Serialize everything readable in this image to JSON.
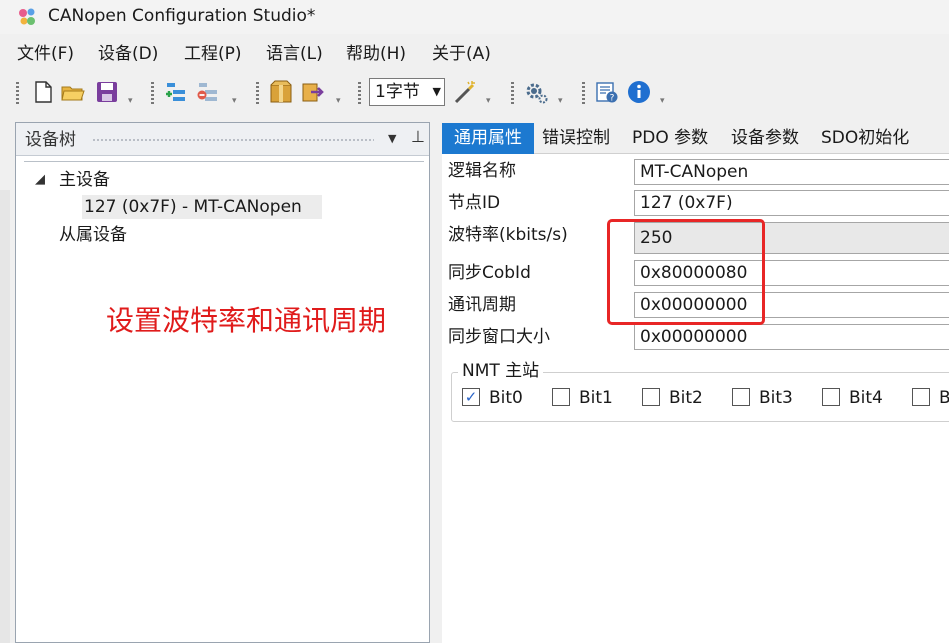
{
  "window": {
    "title": "CANopen Configuration Studio*"
  },
  "menu": {
    "items": [
      "文件(F)",
      "设备(D)",
      "工程(P)",
      "语言(L)",
      "帮助(H)",
      "关于(A)"
    ]
  },
  "toolbar": {
    "icons": [
      "new-file-icon",
      "open-folder-icon",
      "save-icon",
      "add-device-icon",
      "remove-device-icon",
      "package-icon",
      "export-icon",
      "wand-icon",
      "settings-gear-icon",
      "help-icon",
      "info-icon"
    ],
    "byte_select": {
      "value": "1字节"
    }
  },
  "device_tree": {
    "title": "设备树",
    "master_label": "主设备",
    "master_child": "127 (0x7F)  -  MT-CANopen",
    "slave_label": "从属设备"
  },
  "annotation": {
    "text": "设置波特率和通讯周期",
    "color": "#e01b1b"
  },
  "tabs": [
    "通用属性",
    "错误控制",
    "PDO 参数",
    "设备参数",
    "SDO初始化"
  ],
  "properties": [
    {
      "label": "逻辑名称",
      "value": "MT-CANopen"
    },
    {
      "label": "节点ID",
      "value": "127 (0x7F)"
    },
    {
      "label": "波特率(kbits/s)",
      "value": "250"
    },
    {
      "label": "同步CobId",
      "value": "0x80000080"
    },
    {
      "label": "通讯周期",
      "value": "0x00000000"
    },
    {
      "label": "同步窗口大小",
      "value": "0x00000000"
    }
  ],
  "nmt_master": {
    "title": "NMT 主站",
    "bits": [
      {
        "label": "Bit0",
        "checked": true
      },
      {
        "label": "Bit1",
        "checked": false
      },
      {
        "label": "Bit2",
        "checked": false
      },
      {
        "label": "Bit3",
        "checked": false
      },
      {
        "label": "Bit4",
        "checked": false
      },
      {
        "label": "B",
        "checked": false
      }
    ]
  },
  "colors": {
    "accent": "#1c79d0",
    "highlight_box": "#e82626"
  }
}
